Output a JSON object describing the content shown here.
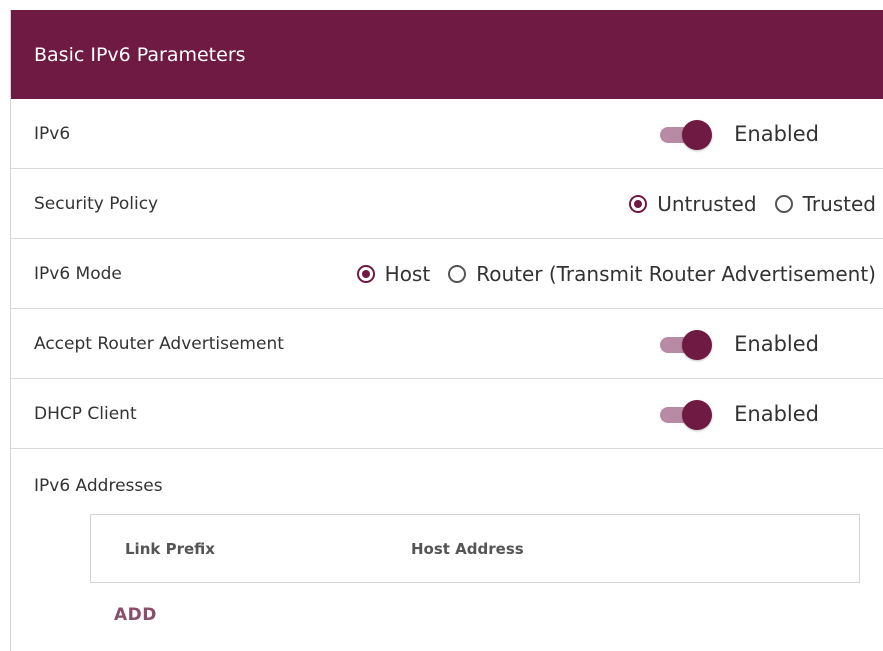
{
  "panel": {
    "title": "Basic IPv6 Parameters"
  },
  "rows": {
    "ipv6": {
      "label": "IPv6",
      "toggle_state": "Enabled",
      "on": true
    },
    "security_policy": {
      "label": "Security Policy",
      "options": [
        {
          "label": "Untrusted",
          "selected": true
        },
        {
          "label": "Trusted",
          "selected": false
        }
      ]
    },
    "ipv6_mode": {
      "label": "IPv6 Mode",
      "options": [
        {
          "label": "Host",
          "selected": true
        },
        {
          "label": "Router (Transmit Router Advertisement)",
          "selected": false
        }
      ]
    },
    "accept_ra": {
      "label": "Accept Router Advertisement",
      "toggle_state": "Enabled",
      "on": true
    },
    "dhcp_client": {
      "label": "DHCP Client",
      "toggle_state": "Enabled",
      "on": true
    }
  },
  "addresses": {
    "label": "IPv6 Addresses",
    "columns": [
      "Link Prefix",
      "Host Address"
    ],
    "add_label": "ADD"
  },
  "colors": {
    "accent": "#6e1a43",
    "toggle_track": "#b98aa3",
    "add_link": "#8b4d6c"
  },
  "icons": {
    "radio_selected": "radio-selected-icon",
    "radio_unselected": "radio-unselected-icon"
  }
}
